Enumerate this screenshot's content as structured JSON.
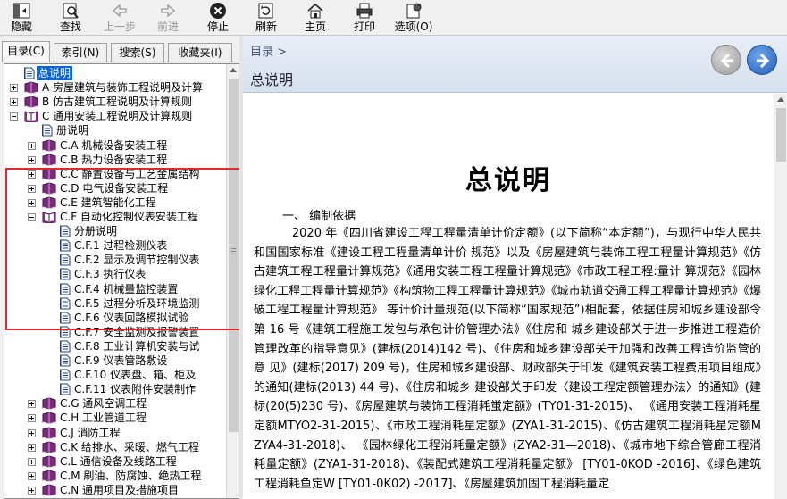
{
  "toolbar": {
    "hide": "隐藏",
    "find": "查找",
    "back": "上一步",
    "forward": "前进",
    "stop": "停止",
    "refresh": "刷新",
    "home": "主页",
    "print": "打印",
    "options": "选项(O)"
  },
  "tabs": [
    "目录(C)",
    "索引(N)",
    "搜索(S)",
    "收藏夹(I)"
  ],
  "tree": [
    {
      "label": "总说明",
      "level": 0,
      "kind": "page",
      "selected": true
    },
    {
      "label": "A 房屋建筑与装饰工程说明及计算",
      "level": 0,
      "kind": "book",
      "expander": "plus"
    },
    {
      "label": "B 仿古建筑工程说明及计算规则",
      "level": 0,
      "kind": "book",
      "expander": "plus"
    },
    {
      "label": "C 通用安装工程说明及计算规则",
      "level": 0,
      "kind": "openbook",
      "expander": "minus"
    },
    {
      "label": "册说明",
      "level": 1,
      "kind": "page"
    },
    {
      "label": "C.A 机械设备安装工程",
      "level": 1,
      "kind": "book",
      "expander": "plus"
    },
    {
      "label": "C.B 热力设备安装工程",
      "level": 1,
      "kind": "book",
      "expander": "plus"
    },
    {
      "label": "C.C 静置设备与工艺金属结构",
      "level": 1,
      "kind": "book",
      "expander": "plus"
    },
    {
      "label": "C.D 电气设备安装工程",
      "level": 1,
      "kind": "book",
      "expander": "plus"
    },
    {
      "label": "C.E 建筑智能化工程",
      "level": 1,
      "kind": "book",
      "expander": "plus"
    },
    {
      "label": "C.F 自动化控制仪表安装工程",
      "level": 1,
      "kind": "openbook",
      "expander": "minus"
    },
    {
      "label": "分册说明",
      "level": 2,
      "kind": "page"
    },
    {
      "label": "C.F.1 过程检测仪表",
      "level": 2,
      "kind": "page"
    },
    {
      "label": "C.F.2 显示及调节控制仪表",
      "level": 2,
      "kind": "page"
    },
    {
      "label": "C.F.3 执行仪表",
      "level": 2,
      "kind": "page"
    },
    {
      "label": "C.F.4 机械量监控装置",
      "level": 2,
      "kind": "page"
    },
    {
      "label": "C.F.5 过程分析及环境监测",
      "level": 2,
      "kind": "page"
    },
    {
      "label": "C.F.6 仪表回路模拟试验",
      "level": 2,
      "kind": "page"
    },
    {
      "label": "C.F.7 安全监测及报警装置",
      "level": 2,
      "kind": "page"
    },
    {
      "label": "C.F.8 工业计算机安装与试",
      "level": 2,
      "kind": "page"
    },
    {
      "label": "C.F.9 仪表管路敷设",
      "level": 2,
      "kind": "page"
    },
    {
      "label": "C.F.10 仪表盘、箱、柜及",
      "level": 2,
      "kind": "page"
    },
    {
      "label": "C.F.11 仪表附件安装制作",
      "level": 2,
      "kind": "page"
    },
    {
      "label": "C.G 通风空调工程",
      "level": 1,
      "kind": "book",
      "expander": "plus"
    },
    {
      "label": "C.H 工业管道工程",
      "level": 1,
      "kind": "book",
      "expander": "plus"
    },
    {
      "label": "C.J 消防工程",
      "level": 1,
      "kind": "book",
      "expander": "plus"
    },
    {
      "label": "C.K 给排水、采暖、燃气工程",
      "level": 1,
      "kind": "book",
      "expander": "plus"
    },
    {
      "label": "C.L 通信设备及线路工程",
      "level": 1,
      "kind": "book",
      "expander": "plus"
    },
    {
      "label": "C.M 刷油、防腐蚀、绝热工程",
      "level": 1,
      "kind": "book",
      "expander": "plus"
    },
    {
      "label": "C.N 通用项目及措施项目",
      "level": 1,
      "kind": "book",
      "expander": "plus"
    }
  ],
  "topic": {
    "breadcrumb": "目录 >",
    "header_title": "总说明",
    "title": "总说明",
    "section": "一、 编制依据",
    "paragraph": "2020 年《四川省建设工程工程量清单计价定额》(以下简称“本定额”)，与现行中华人民共和国国家标准《建设工程工程量清单计价 规范》以及《房屋建筑与装饰工程工程量计算规范》《仿古建筑工程工程量计算规范》《通用安装工程工程量计算规范》《市政工程工程:量计 算规范》《园林绿化工程工程量计算规范》《构筑物工程工程量计算规范》《城市轨道交通工程工程量计算规范》《爆破工程工程量计算规范》 等计价计量规范(以下简称“国家规范”)相配套，依据住房和城乡建设部令第 16 号《建筑工程施工发包与承包计价管理办法》《住房和 城乡建设部关于进一步推进工程造价管理改革的指导意见》(建标(2014)142 号)、《住房和城乡建设部关于加强和改善工程造价监管的意 见》(建标(2017) 209 号)，住房和城乡建设部、财政部关于印发《建筑安装工程费用项目组成》的通知(建标(2013) 44 号)、《住房和城乡 建设部关于印发〈建设工程定额管理办法〉的通知》(建标(20(5)230 号)、《房屋建筑与装饰工程消耗蛍定额》(TY01-31-2015)、 《通用安装工程消耗星定额MTYO2-31-2015)、《市政工程消耗星定额》(ZYA1-31-2015)、《仿古建筑工程消耗星定额MZYA4-31-2018)、 《园林绿化工程消耗量定额》(ZYA2-31—2018)、《城市地下综合管廊工程消耗量定额》(ZYA1-31-2018)、《装配式建筑工程消耗量定额》 [TY01-0KOD -2016]、《绿色建筑工程消耗鱼定W [TY01-0K02) -2017]、《房屋建筑加固工程消耗量定"
  }
}
